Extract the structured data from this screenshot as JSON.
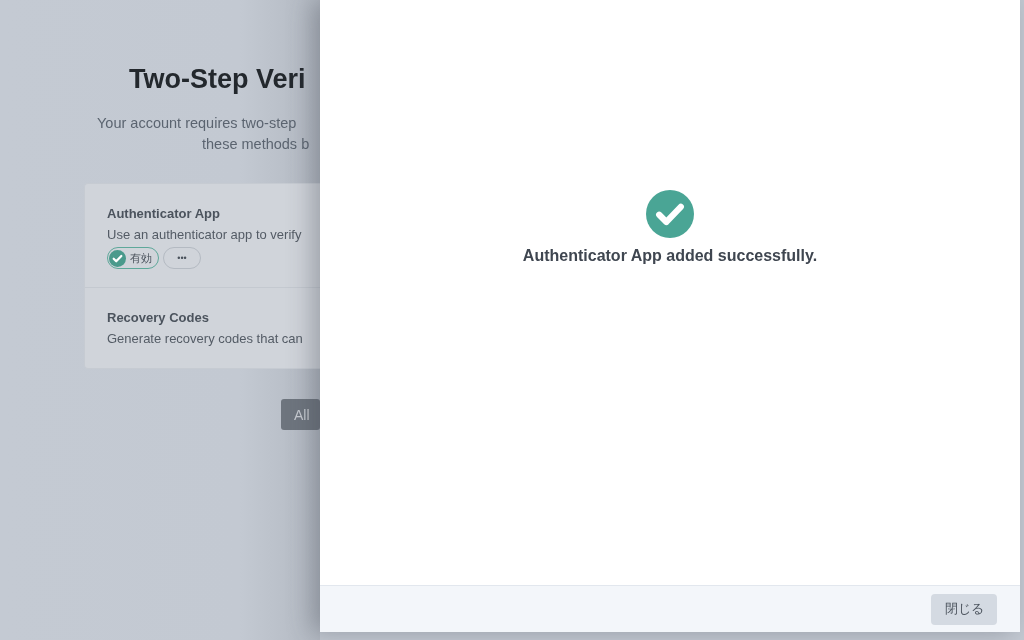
{
  "page": {
    "title": "Two-Step Veri",
    "subtitle_lines": [
      "Your account requires two-step",
      "these methods b"
    ],
    "methods": [
      {
        "name": "Authenticator App",
        "description": "Use an authenticator app to verify",
        "status": {
          "label": "有効",
          "on": true
        },
        "more": "•••"
      },
      {
        "name": "Recovery Codes",
        "description": "Generate recovery codes that can"
      }
    ],
    "button": "All"
  },
  "drawer": {
    "message": "Authenticator App added successfully.",
    "close_button": "閉じる"
  }
}
